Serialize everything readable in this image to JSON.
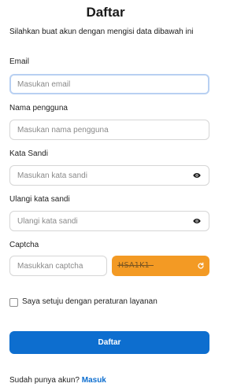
{
  "header": {
    "title": "Daftar",
    "subtitle": "Silahkan buat akun dengan mengisi data dibawah ini"
  },
  "form": {
    "email": {
      "label": "Email",
      "placeholder": "Masukan email",
      "value": ""
    },
    "username": {
      "label": "Nama pengguna",
      "placeholder": "Masukan nama pengguna",
      "value": ""
    },
    "password": {
      "label": "Kata Sandi",
      "placeholder": "Masukan kata sandi",
      "value": "",
      "icon": "eye-icon"
    },
    "confirm_password": {
      "label": "Ulangi kata sandi",
      "placeholder": "Ulangi kata sandi",
      "value": "",
      "icon": "eye-icon"
    },
    "captcha": {
      "label": "Captcha",
      "placeholder": "Masukkan captcha",
      "value": "",
      "code": "HSA1K1",
      "refresh_icon": "refresh-icon",
      "box_color": "#f39a24"
    },
    "terms": {
      "label": "Saya setuju dengan peraturan layanan",
      "checked": false
    },
    "submit_label": "Daftar"
  },
  "footer": {
    "prompt": "Sudah punya akun?",
    "login_link": "Masuk"
  },
  "colors": {
    "primary": "#0d6ecf",
    "focus_border": "#b8d0f2",
    "captcha": "#f39a24"
  }
}
